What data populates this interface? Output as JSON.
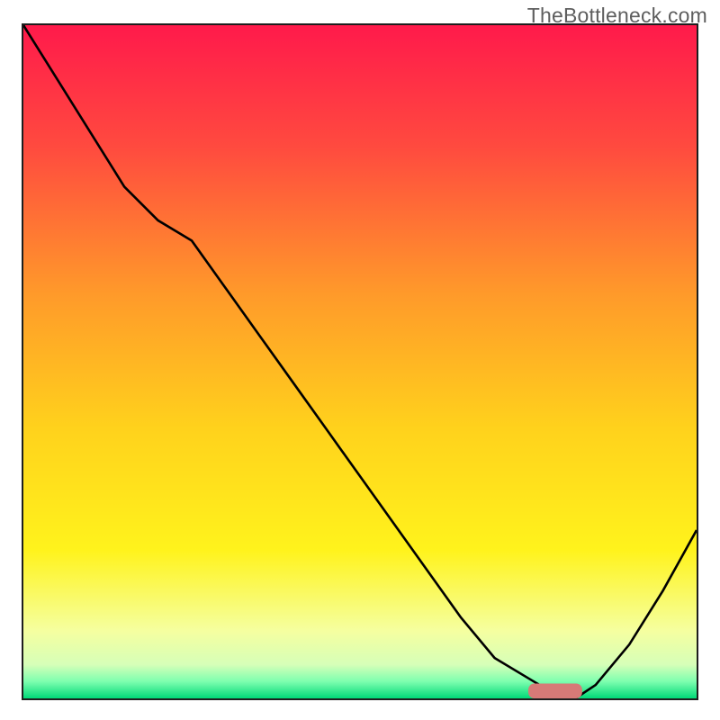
{
  "watermark": "TheBottleneck.com",
  "colors": {
    "curve": "#000000",
    "sweet_bar": "#d77a77",
    "frame": "#1e1e1e"
  },
  "chart_data": {
    "type": "line",
    "title": "",
    "xlabel": "",
    "ylabel": "",
    "xlim": [
      0,
      100
    ],
    "ylim": [
      0,
      100
    ],
    "x": [
      0,
      5,
      10,
      15,
      20,
      25,
      30,
      35,
      40,
      45,
      50,
      55,
      60,
      65,
      70,
      75,
      80,
      82,
      85,
      90,
      95,
      100
    ],
    "y": [
      100,
      92,
      84,
      76,
      71,
      68,
      61,
      54,
      47,
      40,
      33,
      26,
      19,
      12,
      6,
      3,
      0,
      0,
      2,
      8,
      16,
      25
    ],
    "gradient_stops": [
      {
        "offset": 0.0,
        "color": "#ff1a4b"
      },
      {
        "offset": 0.18,
        "color": "#ff4a3f"
      },
      {
        "offset": 0.4,
        "color": "#ff9a2a"
      },
      {
        "offset": 0.6,
        "color": "#ffd21c"
      },
      {
        "offset": 0.78,
        "color": "#fff31c"
      },
      {
        "offset": 0.9,
        "color": "#f5ffa0"
      },
      {
        "offset": 0.95,
        "color": "#d6ffb8"
      },
      {
        "offset": 0.975,
        "color": "#7dffaf"
      },
      {
        "offset": 1.0,
        "color": "#00d977"
      }
    ],
    "sweet_spot": {
      "x_start": 75,
      "x_end": 83,
      "y": 0,
      "height": 2.2
    }
  }
}
